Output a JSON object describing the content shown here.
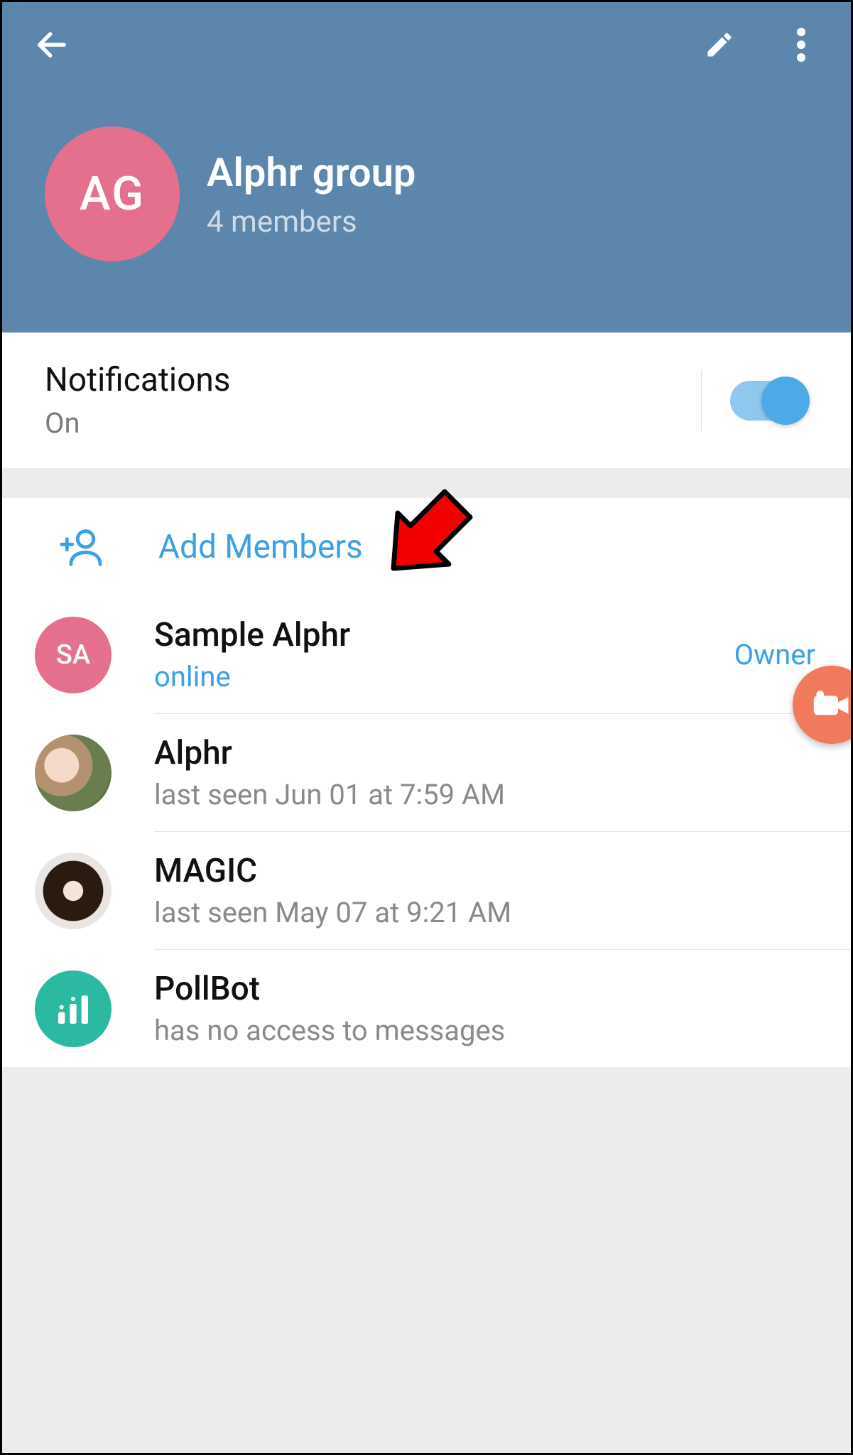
{
  "header": {
    "group_title": "Alphr group",
    "group_subtitle": "4 members",
    "avatar_initials": "AG"
  },
  "notifications": {
    "title": "Notifications",
    "state_label": "On",
    "enabled": true
  },
  "members_section": {
    "add_label": "Add Members"
  },
  "members": [
    {
      "name": "Sample Alphr",
      "status": "online",
      "status_class": "online",
      "badge": "Owner",
      "avatar_type": "initials",
      "avatar_value": "SA",
      "avatar_class": "pink"
    },
    {
      "name": "Alphr",
      "status": "last seen Jun 01 at 7:59 AM",
      "status_class": "grey",
      "badge": "",
      "avatar_type": "photo",
      "avatar_value": "",
      "avatar_class": "photo1"
    },
    {
      "name": "MAGIC",
      "status": "last seen May 07 at 9:21 AM",
      "status_class": "grey",
      "badge": "",
      "avatar_type": "photo",
      "avatar_value": "",
      "avatar_class": "photo2"
    },
    {
      "name": "PollBot",
      "status": "has no access to messages",
      "status_class": "grey",
      "badge": "",
      "avatar_type": "icon",
      "avatar_value": "bars",
      "avatar_class": "teal"
    }
  ],
  "annotation": {
    "arrow_target": "add-members-button"
  }
}
